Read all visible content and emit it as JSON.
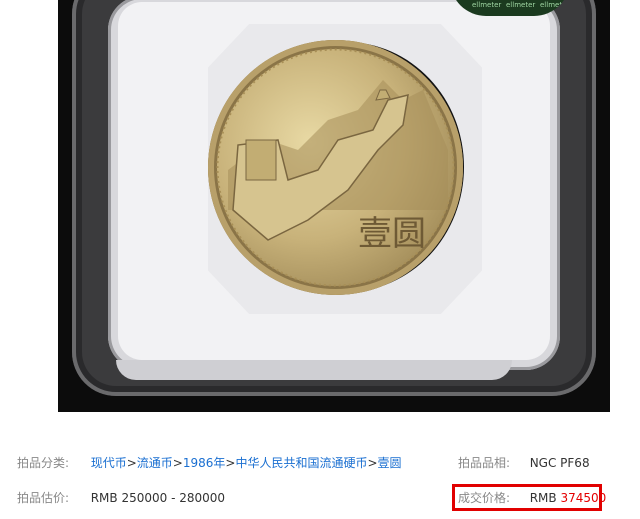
{
  "photo": {
    "coin_face_text": "壹圆",
    "holder_label_text": [
      "ellmeter",
      "ellmeter",
      "ellmeter"
    ]
  },
  "info": {
    "category_label": "拍品分类:",
    "breadcrumb": [
      "现代币",
      "流通币",
      "1986年",
      "中华人民共和国流通硬币",
      "壹圆"
    ],
    "breadcrumb_separator": ">",
    "grade_label": "拍品品相:",
    "grade_value": "NGC PF68",
    "estimate_label": "拍品估价:",
    "estimate_value": "RMB 250000 - 280000",
    "deal_label": "成交价格:",
    "deal_currency": "RMB",
    "deal_amount": "374500"
  },
  "colors": {
    "link": "#1a6fd1",
    "highlight": "#e40000",
    "box_border": "#e10000"
  }
}
